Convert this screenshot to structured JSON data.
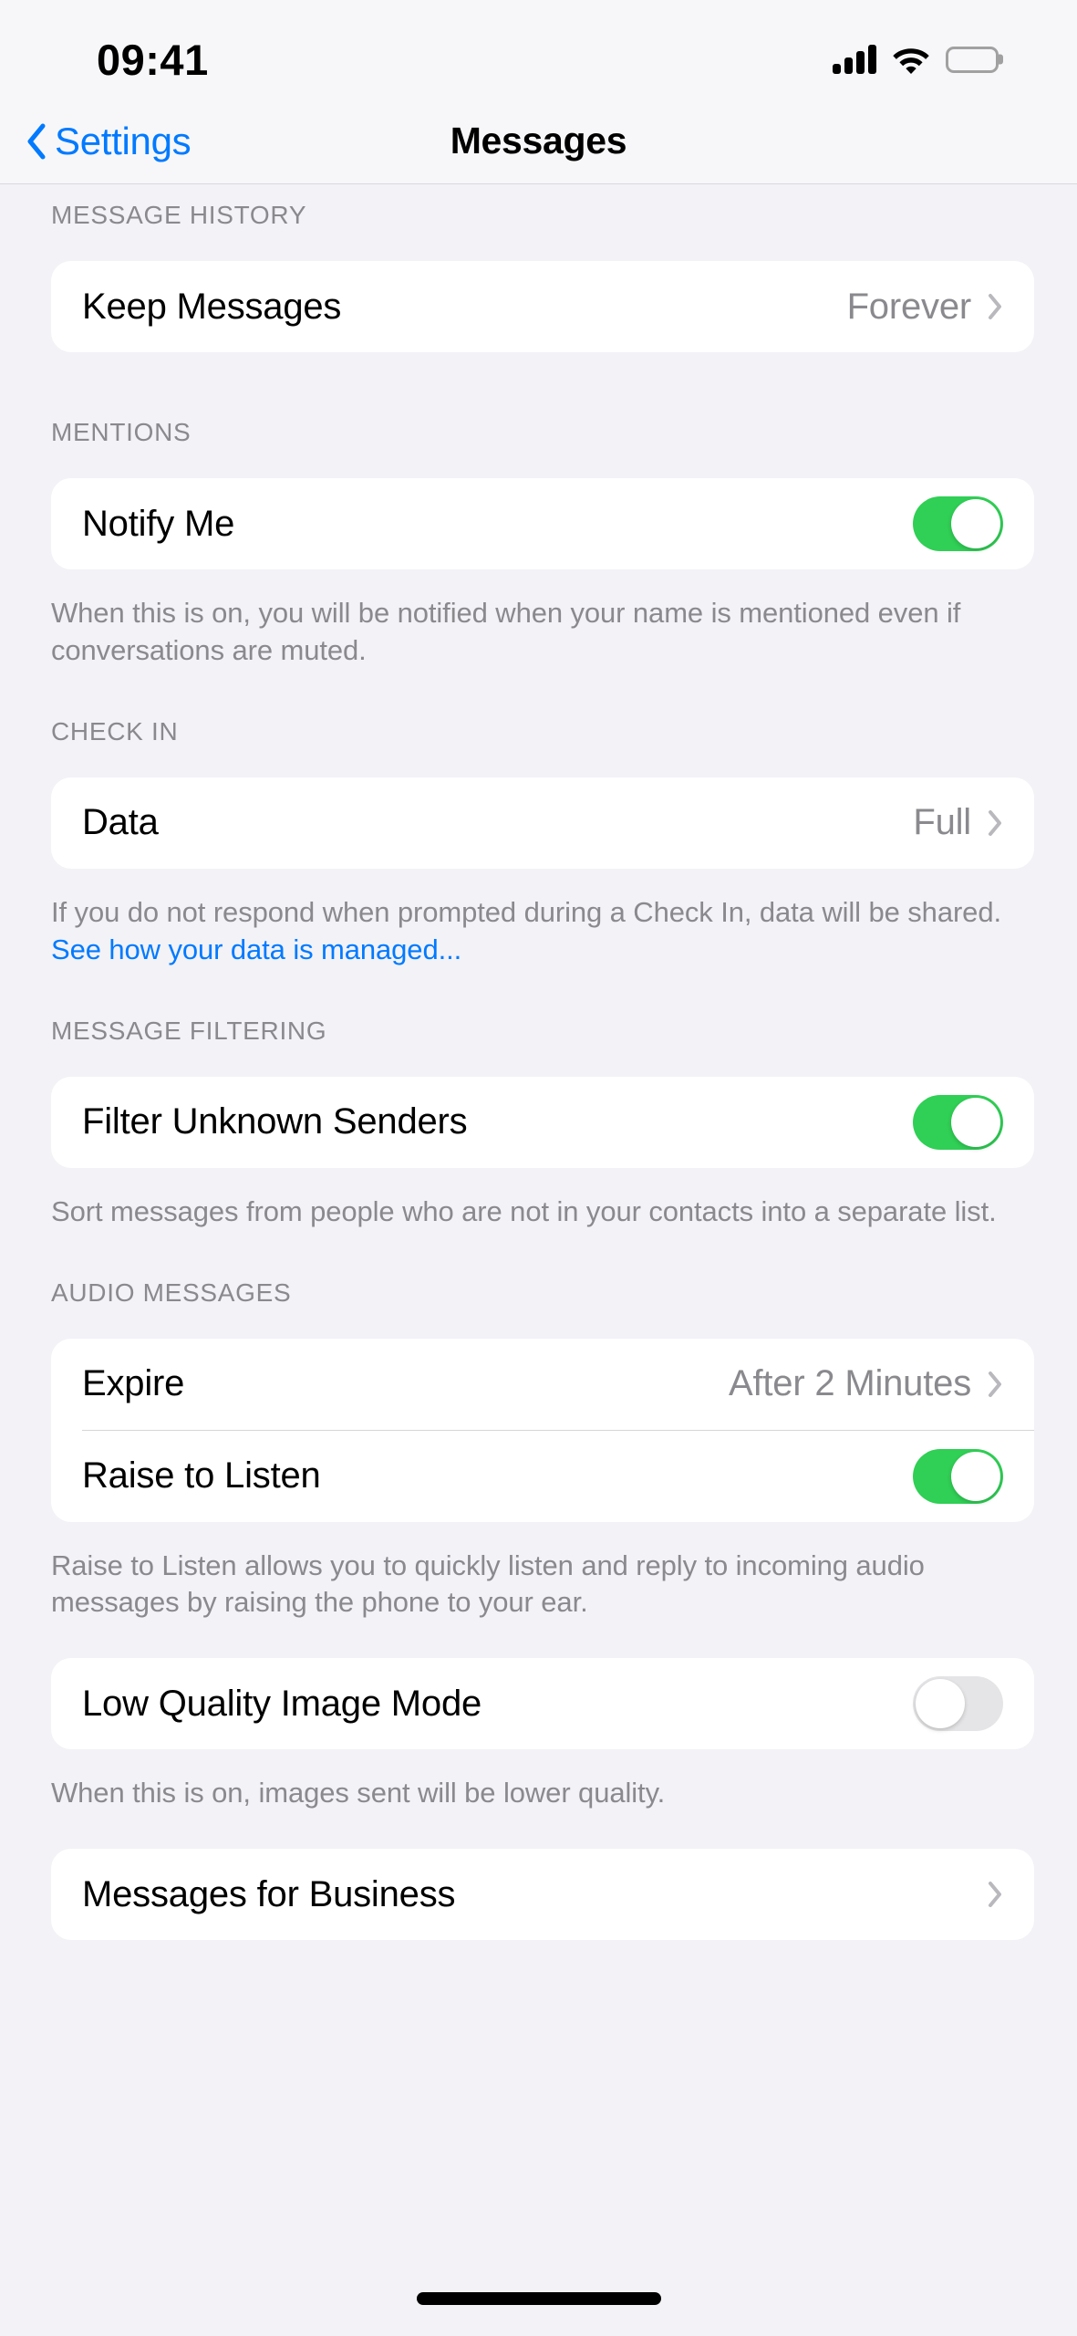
{
  "status_bar": {
    "time": "09:41",
    "icons": [
      "cellular-signal-icon",
      "wifi-icon",
      "battery-icon"
    ]
  },
  "nav": {
    "back_label": "Settings",
    "title": "Messages",
    "back_icon": "chevron-left-icon"
  },
  "colors": {
    "accent_blue": "#007AFF",
    "toggle_on_green": "#30CF55",
    "toggle_off_gray": "#E5E5E7",
    "page_background": "#F2F2F7",
    "card_background": "#FFFFFF",
    "secondary_text": "#8A8A8E"
  },
  "sections": [
    {
      "header": "MESSAGE HISTORY",
      "rows": [
        {
          "label": "Keep Messages",
          "value": "Forever",
          "type": "disclosure"
        }
      ],
      "footnote": ""
    },
    {
      "header": "MENTIONS",
      "rows": [
        {
          "label": "Notify Me",
          "type": "toggle",
          "state": "on"
        }
      ],
      "footnote": "When this is on, you will be notified when your name is mentioned even if conversations are muted."
    },
    {
      "header": "CHECK IN",
      "rows": [
        {
          "label": "Data",
          "value": "Full",
          "type": "disclosure"
        }
      ],
      "footnote_prefix": "If you do not respond when prompted during a Check In, data will be shared. ",
      "footnote_link": "See how your data is managed..."
    },
    {
      "header": "MESSAGE FILTERING",
      "rows": [
        {
          "label": "Filter Unknown Senders",
          "type": "toggle",
          "state": "on"
        }
      ],
      "footnote": "Sort messages from people who are not in your contacts into a separate list."
    },
    {
      "header": "AUDIO MESSAGES",
      "rows": [
        {
          "label": "Expire",
          "value": "After 2 Minutes",
          "type": "disclosure"
        },
        {
          "label": "Raise to Listen",
          "type": "toggle",
          "state": "on"
        }
      ],
      "footnote": "Raise to Listen allows you to quickly listen and reply to incoming audio messages by raising the phone to your ear."
    },
    {
      "header": "",
      "rows": [
        {
          "label": "Low Quality Image Mode",
          "type": "toggle",
          "state": "off"
        }
      ],
      "footnote": "When this is on, images sent will be lower quality."
    },
    {
      "header": "",
      "rows": [
        {
          "label": "Messages for Business",
          "value": "",
          "type": "disclosure"
        }
      ],
      "footnote": ""
    }
  ]
}
